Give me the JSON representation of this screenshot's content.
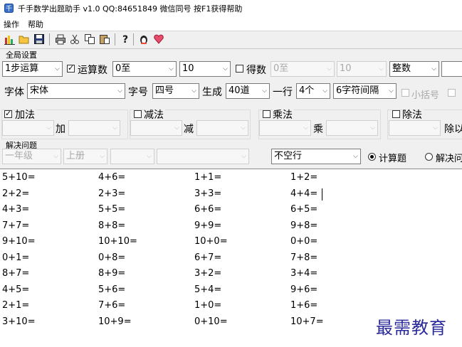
{
  "title": "千手数学出题助手 v1.0     QQ:84651849   微信同号   按F1获得帮助",
  "menu": [
    "操作",
    "帮助"
  ],
  "toolbar_icons": [
    "chart-icon",
    "open-folder-icon",
    "save-icon",
    "print-icon",
    "cut-icon",
    "copy-icon",
    "paste-icon",
    "help-icon",
    "qq-penguin-icon",
    "heart-icon"
  ],
  "global": {
    "section_label": "全局设置",
    "steps": "1步运算",
    "operand_count_label": "运算数",
    "operand_count_checked": true,
    "operand_from": "0至",
    "operand_to": "10",
    "result_label": "得数",
    "result_checked": false,
    "result_from": "0至",
    "result_to": "10",
    "number_type": "整数",
    "font_label": "字体",
    "font_value": "宋体",
    "size_label": "字号",
    "size_value": "四号",
    "generate_label": "生成",
    "generate_value": "40道",
    "per_row_label": "一行",
    "per_row_value": "4个",
    "spacing_value": "6字符间隔",
    "bracket_label": "小括号",
    "bracket_checked": false
  },
  "ops": {
    "add": {
      "label": "加法",
      "checked": true,
      "mid": "加"
    },
    "sub": {
      "label": "减法",
      "checked": false,
      "mid": "减"
    },
    "mul": {
      "label": "乘法",
      "checked": false,
      "mid": "乘"
    },
    "div": {
      "label": "除法",
      "checked": false,
      "mid": "除以"
    }
  },
  "solve": {
    "section_label": "解决问题",
    "grade": "一年级",
    "term": "上册",
    "line_mode": "不空行",
    "radio_calc": "计算题",
    "radio_solve": "解决问",
    "calc_selected": true
  },
  "problems": [
    [
      "5+10=",
      "4+6=",
      "1+1=",
      "1+2="
    ],
    [
      "2+2=",
      "2+3=",
      "3+3=",
      "4+4="
    ],
    [
      "4+3=",
      "5+5=",
      "6+6=",
      "6+5="
    ],
    [
      "7+7=",
      "8+8=",
      "9+9=",
      "9+8="
    ],
    [
      "9+10=",
      "10+10=",
      "10+0=",
      "0+0="
    ],
    [
      "0+1=",
      "0+8=",
      "6+7=",
      "7+8="
    ],
    [
      "8+7=",
      "8+9=",
      "3+2=",
      "3+4="
    ],
    [
      "4+5=",
      "5+6=",
      "5+4=",
      "9+6="
    ],
    [
      "2+1=",
      "7+6=",
      "1+0=",
      "1+6="
    ],
    [
      "3+10=",
      "10+9=",
      "0+10=",
      "10+7="
    ]
  ],
  "watermark": "最需教育",
  "colors": {
    "accent": "#0078d7",
    "watermark": "#2a2a9a"
  }
}
